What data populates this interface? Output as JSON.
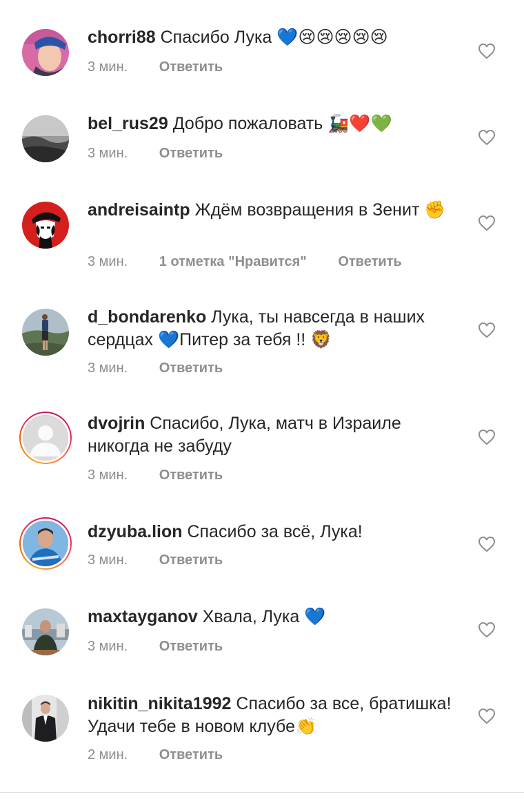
{
  "comments": [
    {
      "username": "chorri88",
      "text": "Спасибо Лука 💙😢😢😢😢😢",
      "time": "3 мин.",
      "likes": "",
      "reply": "Ответить",
      "story": false
    },
    {
      "username": "bel_rus29",
      "text": "Добро пожаловать 🚂❤️💚",
      "time": "3 мин.",
      "likes": "",
      "reply": "Ответить",
      "story": false
    },
    {
      "username": "andreisaintp",
      "text": "Ждём возвращения в Зенит ✊",
      "time": "3 мин.",
      "likes": "1 отметка \"Нравится\"",
      "reply": "Ответить",
      "story": false
    },
    {
      "username": "d_bondarenko",
      "text": "Лука,  ты навсегда в наших сердцах 💙Питер за тебя !! 🦁",
      "time": "3 мин.",
      "likes": "",
      "reply": "Ответить",
      "story": false
    },
    {
      "username": "dvojrin",
      "text": "Спасибо, Лука, матч в Израиле никогда не забуду",
      "time": "3 мин.",
      "likes": "",
      "reply": "Ответить",
      "story": true
    },
    {
      "username": "dzyuba.lion",
      "text": "Спасибо за всё, Лука!",
      "time": "3 мин.",
      "likes": "",
      "reply": "Ответить",
      "story": true
    },
    {
      "username": "maxtayganov",
      "text": "Хвала, Лука 💙",
      "time": "3 мин.",
      "likes": "",
      "reply": "Ответить",
      "story": false
    },
    {
      "username": "nikitin_nikita1992",
      "text": "Спасибо за все, братишка!  Удачи тебе в новом клубе👏",
      "time": "2 мин.",
      "likes": "",
      "reply": "Ответить",
      "story": false
    }
  ]
}
